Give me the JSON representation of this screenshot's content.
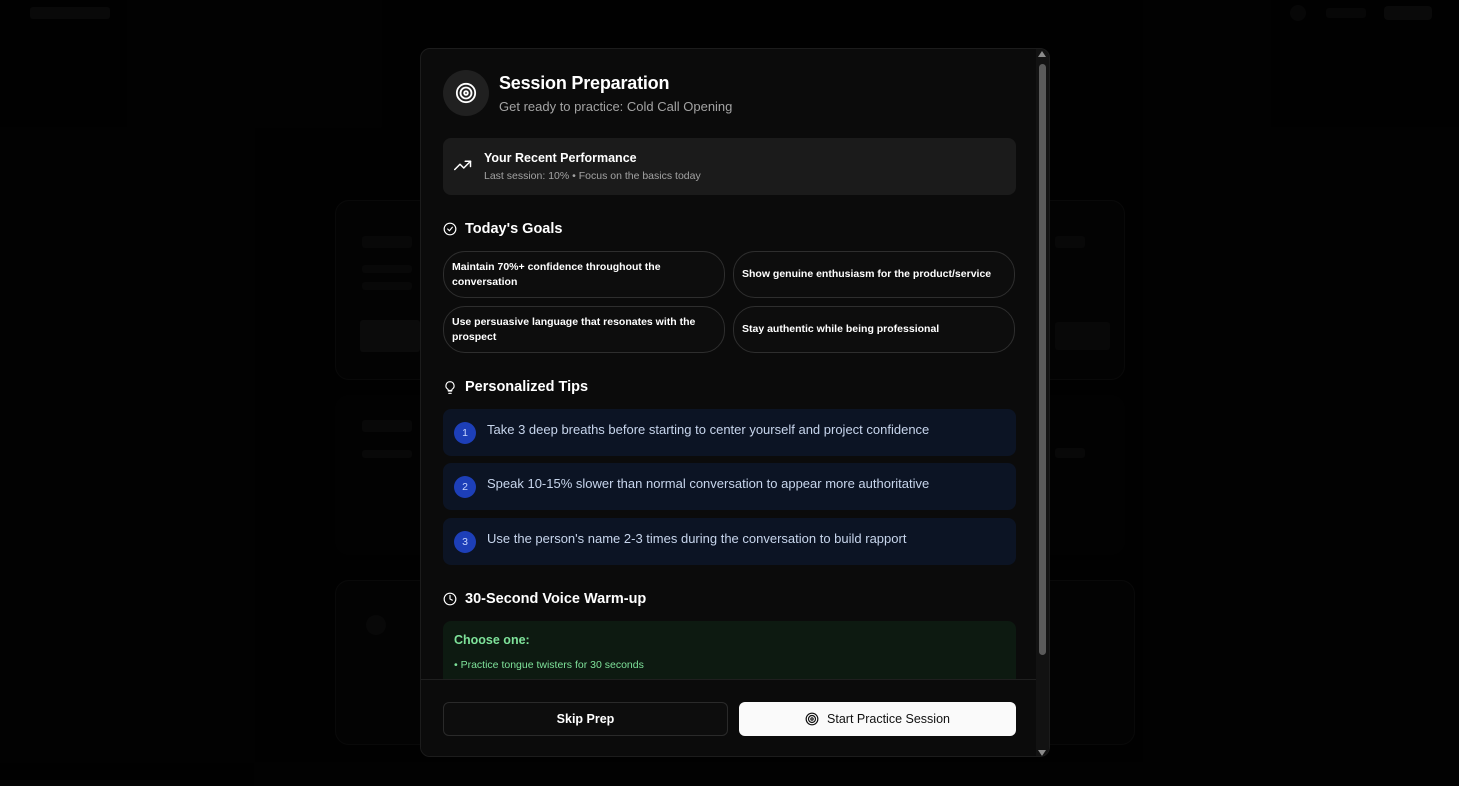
{
  "modal": {
    "title": "Session Preparation",
    "subtitle": "Get ready to practice: Cold Call Opening",
    "header_icon": "target-icon"
  },
  "performance": {
    "title": "Your Recent Performance",
    "subtitle": "Last session: 10% • Focus on the basics today",
    "icon": "trending-up-icon"
  },
  "goals": {
    "heading": "Today's Goals",
    "icon": "check-circle-icon",
    "items": [
      "Maintain 70%+ confidence throughout the conversation",
      "Show genuine enthusiasm for the product/service",
      "Use persuasive language that resonates with the prospect",
      "Stay authentic while being professional"
    ]
  },
  "tips": {
    "heading": "Personalized Tips",
    "icon": "lightbulb-icon",
    "items": [
      {
        "num": "1",
        "text": "Take 3 deep breaths before starting to center yourself and project confidence"
      },
      {
        "num": "2",
        "text": "Speak 10-15% slower than normal conversation to appear more authoritative"
      },
      {
        "num": "3",
        "text": "Use the person's name 2-3 times during the conversation to build rapport"
      }
    ]
  },
  "warmup": {
    "heading": "30-Second Voice Warm-up",
    "icon": "clock-icon",
    "choose_label": "Choose one:",
    "items": [
      "• Practice tongue twisters for 30 seconds"
    ]
  },
  "footer": {
    "skip_label": "Skip Prep",
    "start_label": "Start Practice Session",
    "start_icon": "target-icon"
  },
  "colors": {
    "tip_bg": "#0c1424",
    "tip_badge": "#1d3fb8",
    "warmup_bg": "#0d1a11",
    "warmup_text": "#7ee29a"
  }
}
